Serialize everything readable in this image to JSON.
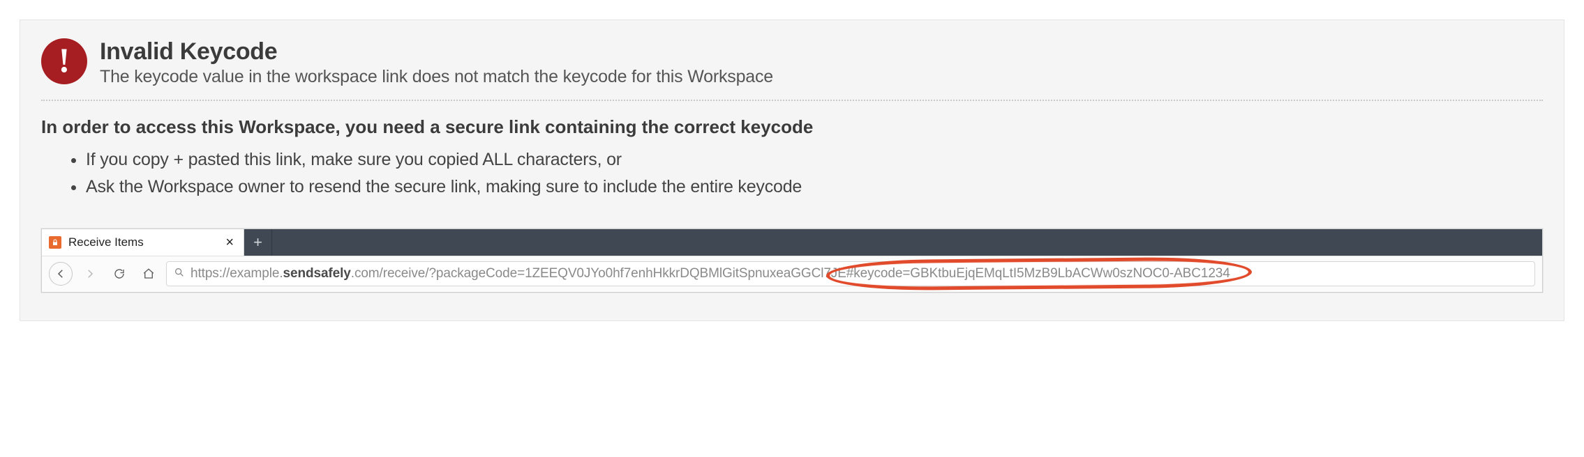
{
  "alert": {
    "icon_glyph": "!",
    "title": "Invalid Keycode",
    "subtitle": "The keycode value in the workspace link does not match the keycode for this Workspace"
  },
  "instructions": {
    "lead": "In order to access this Workspace, you need a secure link containing the correct keycode",
    "items": [
      "If you copy + pasted this link, make sure you copied ALL characters, or",
      "Ask the Workspace owner to resend the secure link, making sure to include the entire keycode"
    ]
  },
  "browser": {
    "tab_title": "Receive Items",
    "url_prefix": "https://example.",
    "url_bold": "sendsafely",
    "url_mid": ".com/receive/?packageCode=1ZEEQV0JYo0hf7enhHkkrDQBMlGitSpnuxeaGGCl7JE",
    "url_keycode": "#keycode=GBKtbuEjqEMqLtI5MzB9LbACWw0szNOC0-ABC1234"
  }
}
